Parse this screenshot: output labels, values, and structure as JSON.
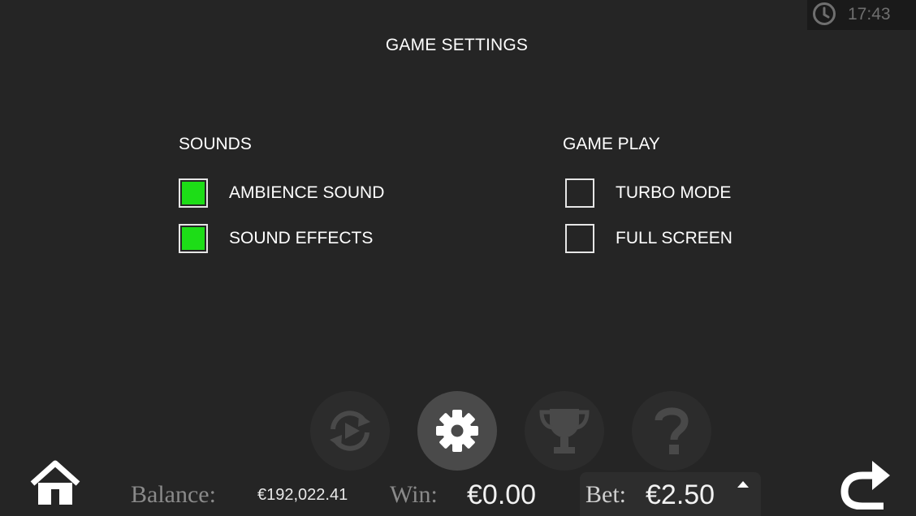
{
  "header": {
    "clock_icon": "clock-icon",
    "time": "17:43",
    "title": "GAME SETTINGS"
  },
  "sounds": {
    "label": "SOUNDS",
    "options": [
      {
        "label": "AMBIENCE SOUND",
        "checked": true
      },
      {
        "label": "SOUND EFFECTS",
        "checked": true
      }
    ]
  },
  "game_play": {
    "label": "GAME PLAY",
    "options": [
      {
        "label": "TURBO MODE",
        "checked": false
      },
      {
        "label": "FULL SCREEN",
        "checked": false
      }
    ]
  },
  "menu_buttons": [
    {
      "icon": "autoplay-icon",
      "active": false
    },
    {
      "icon": "gear-icon",
      "active": true
    },
    {
      "icon": "trophy-icon",
      "active": false
    },
    {
      "icon": "question-mark-icon",
      "active": false
    }
  ],
  "footer": {
    "home_icon": "home-icon",
    "back_icon": "back-arrow-icon",
    "balance_label": "Balance:",
    "balance_value": "€192,022.41",
    "win_label": "Win:",
    "win_value": "€0.00",
    "bet_label": "Bet:",
    "bet_value": "€2.50",
    "bet_caret_icon": "caret-up-icon"
  },
  "colors": {
    "background": "#252525",
    "checkbox_on": "#1ddd17",
    "button_bg": "#2c2c2c",
    "button_active_bg": "#4a4a4a"
  }
}
